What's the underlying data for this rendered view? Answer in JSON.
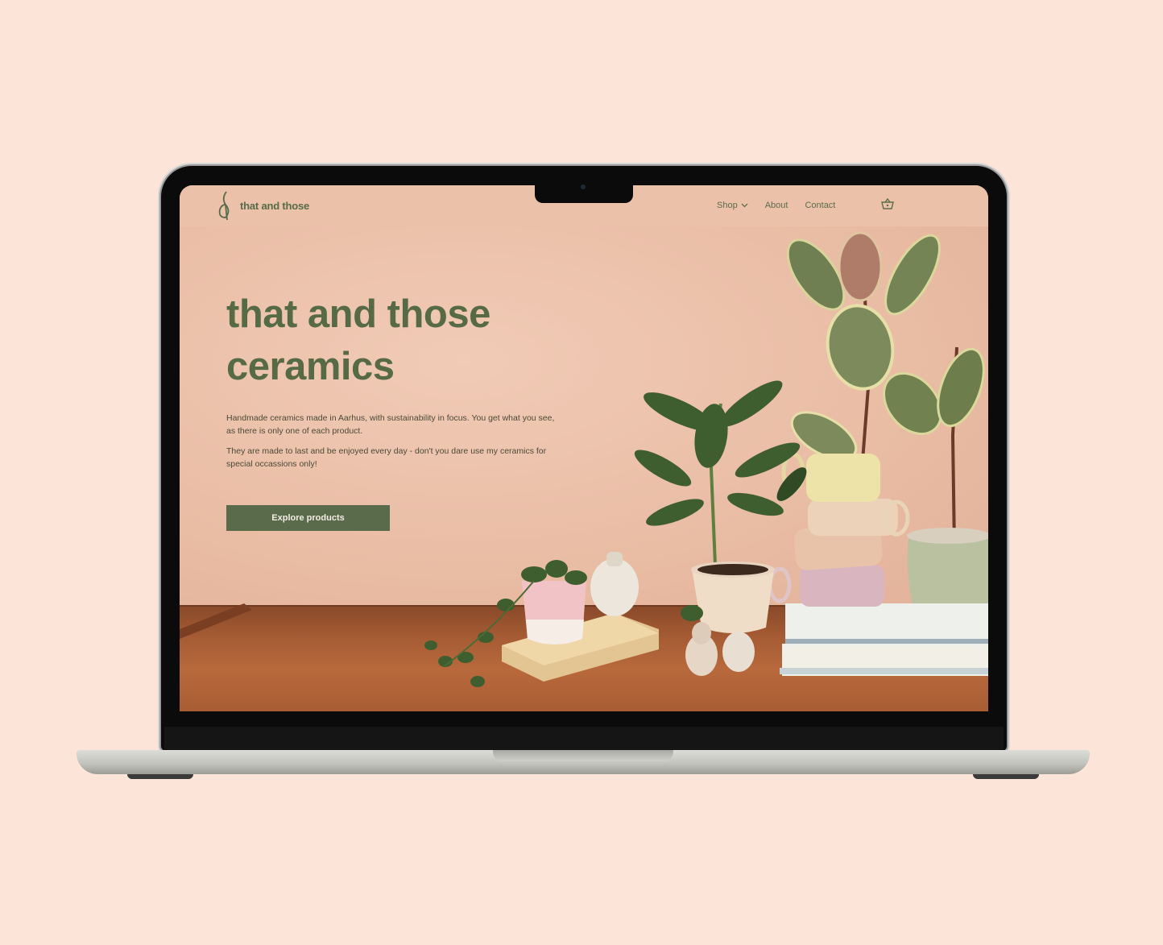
{
  "brand": {
    "name": "that and those",
    "accent": "#596b4b",
    "background": "#fde4d8"
  },
  "nav": {
    "items": [
      {
        "label": "Shop",
        "icon": "chevron-down-icon"
      },
      {
        "label": "About"
      },
      {
        "label": "Contact"
      }
    ],
    "cart_icon": "basket-icon"
  },
  "hero": {
    "title_line1": "that and those",
    "title_line2": "ceramics",
    "paragraph1": "Handmade ceramics made in Aarhus, with sustainability in focus. You get what you see, as there is only one of each product.",
    "paragraph2": "They are made to last and be enjoyed every day - don't you dare use my ceramics for special occassions only!",
    "cta_label": "Explore products"
  }
}
